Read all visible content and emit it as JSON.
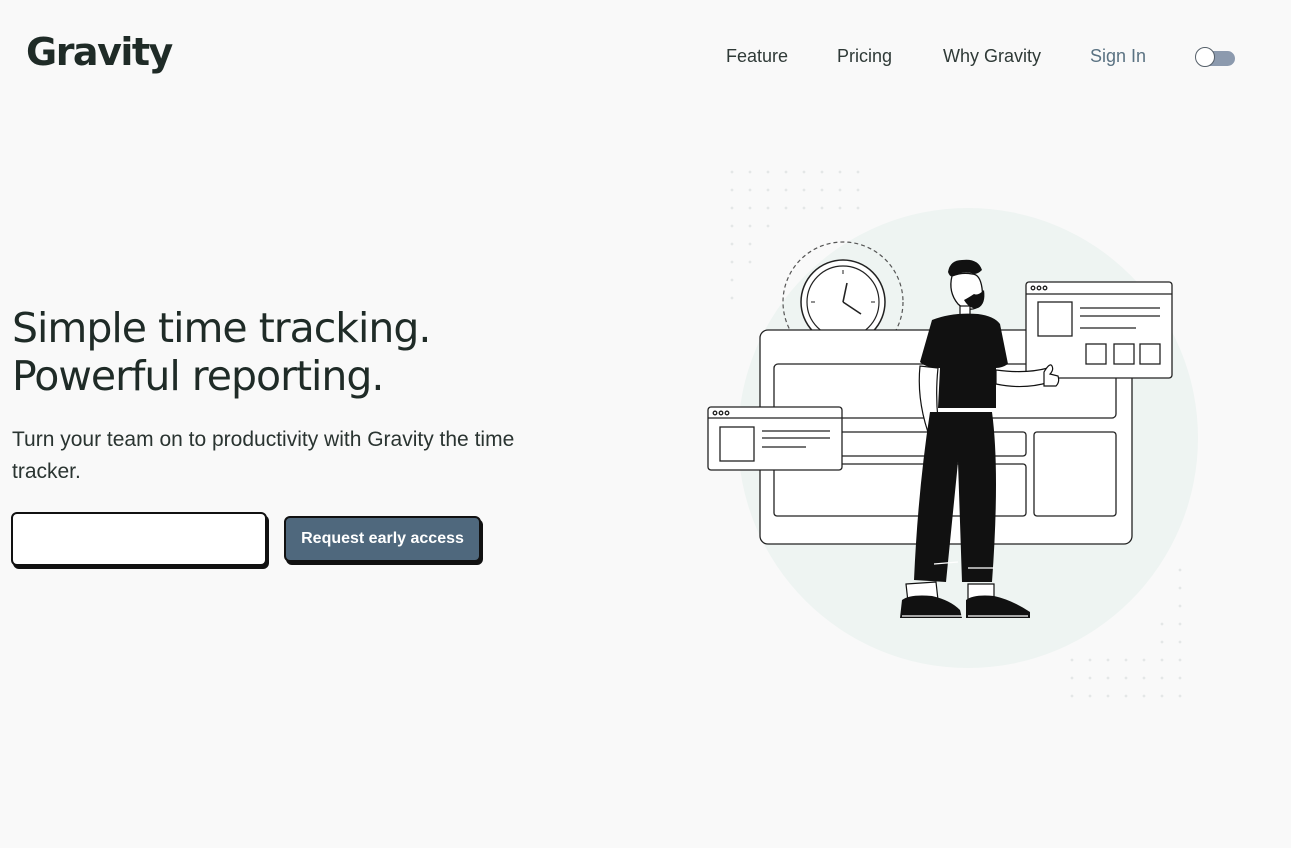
{
  "brand": {
    "name": "Gravity"
  },
  "nav": {
    "items": [
      "Feature",
      "Pricing",
      "Why Gravity"
    ],
    "sign_in": "Sign In"
  },
  "theme_toggle": {
    "state": "off"
  },
  "hero": {
    "headline_line1": "Simple time tracking.",
    "headline_line2": "Powerful reporting.",
    "subtext": "Turn your team on to productivity with Gravity the time tracker.",
    "email_value": "",
    "email_placeholder": "",
    "cta_label": "Request early access"
  },
  "colors": {
    "background": "#f9f9f9",
    "text": "#1f2b27",
    "accent": "#4f687d",
    "sign_in": "#5a7282",
    "toggle_track": "#8c9aae",
    "illustration_circle": "#eef4f2"
  }
}
